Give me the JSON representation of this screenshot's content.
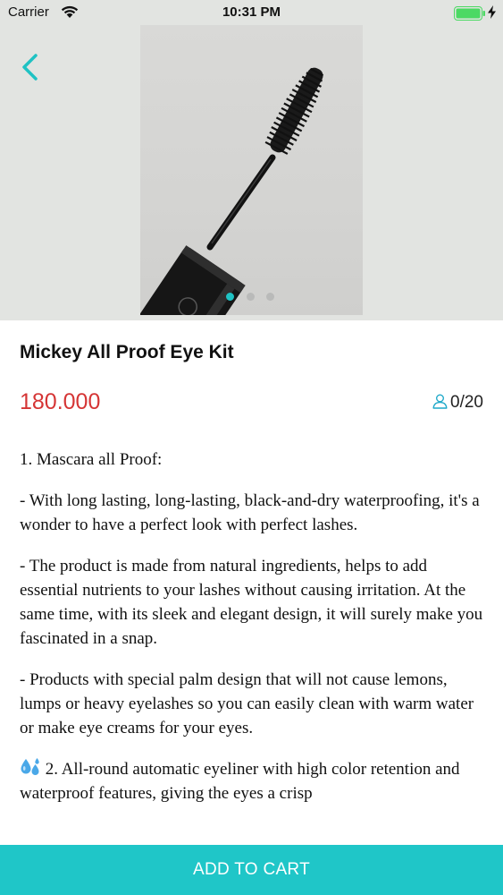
{
  "status_bar": {
    "carrier": "Carrier",
    "time": "10:31 PM"
  },
  "gallery": {
    "image_subject": "mascara wand",
    "page_count": 3,
    "active_page": 1
  },
  "product": {
    "title": "Mickey All Proof Eye Kit",
    "price": "180.000",
    "stock": "0/20"
  },
  "description": {
    "p1": "1. Mascara all Proof:",
    "p2": "- With long lasting, long-lasting, black-and-dry waterproofing, it's a wonder to have a perfect look with perfect lashes.",
    "p3": "- The product is made from natural ingredients, helps to add essential nutrients to your lashes without causing irritation. At the same time, with its sleek and elegant design, it will surely make you fascinated in a snap.",
    "p4": "- Products with special palm design that will not cause lemons, lumps or heavy eyelashes so you can easily clean with warm water or make eye creams for your eyes.",
    "p5": "2. All-round automatic eyeliner with high color retention and waterproof features, giving the eyes a crisp"
  },
  "actions": {
    "add_to_cart": "ADD TO CART"
  },
  "colors": {
    "accent": "#1fc6c8",
    "price": "#d53535",
    "battery": "#4cd964"
  },
  "icons": {
    "back": "chevron-left-icon",
    "stock": "user-icon",
    "droplets": "droplets-icon"
  }
}
